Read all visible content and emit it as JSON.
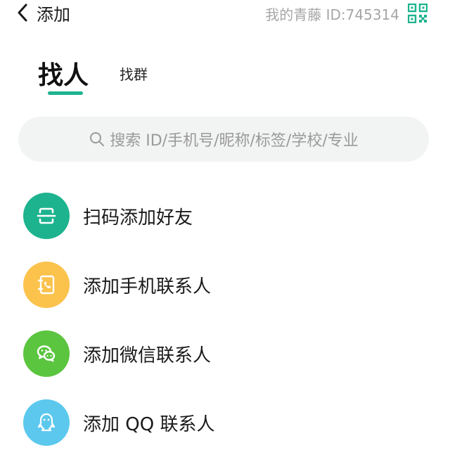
{
  "header": {
    "title": "添加",
    "my_id": "我的青藤 ID:745314",
    "back_icon": "chevron-left-icon",
    "qr_icon": "qr-code-icon"
  },
  "tabs": [
    {
      "label": "找人",
      "selected": true
    },
    {
      "label": "找群",
      "selected": false
    }
  ],
  "search": {
    "placeholder": "搜索 ID/手机号/昵称/标签/学校/专业",
    "icon": "search-icon"
  },
  "actions": [
    {
      "label": "扫码添加好友",
      "icon": "scan-icon",
      "color": "#1db38f"
    },
    {
      "label": "添加手机联系人",
      "icon": "phone-contacts-icon",
      "color": "#fbc24c"
    },
    {
      "label": "添加微信联系人",
      "icon": "wechat-icon",
      "color": "#5bc53f"
    },
    {
      "label": "添加 QQ 联系人",
      "icon": "qq-icon",
      "color": "#5cc8ed"
    }
  ],
  "colors": {
    "accent": "#1db38f",
    "muted_text": "#a6a6a6",
    "search_bg": "#f2f3f3"
  }
}
